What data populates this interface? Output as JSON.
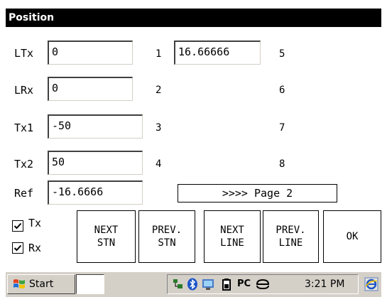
{
  "window": {
    "title": "Position"
  },
  "fields": [
    {
      "label": "LTx",
      "value": "0"
    },
    {
      "label": "LRx",
      "value": "0"
    },
    {
      "label": "Tx1",
      "value": "-50"
    },
    {
      "label": "Tx2",
      "value": "50"
    },
    {
      "label": "Ref",
      "value": "-16.6666"
    }
  ],
  "channels": {
    "col1": [
      "1",
      "2",
      "3",
      "4"
    ],
    "col2": [
      "5",
      "6",
      "7",
      "8"
    ],
    "channel1_value": "16.66666"
  },
  "page_button": "&gt;&gt;&gt;&gt; Page 2",
  "checkboxes": [
    {
      "label": "Tx",
      "checked": true
    },
    {
      "label": "Rx",
      "checked": true
    }
  ],
  "buttons": {
    "next_stn": [
      "NEXT",
      "STN"
    ],
    "prev_stn": [
      "PREV.",
      "STN"
    ],
    "next_line": [
      "NEXT",
      "LINE"
    ],
    "prev_line": [
      "PREV.",
      "LINE"
    ],
    "ok": "OK"
  },
  "taskbar": {
    "start_label": "Start",
    "tray_text_pc": "PC",
    "clock": "3:21 PM",
    "icons": [
      "network-icon",
      "bluetooth-icon",
      "monitor-icon",
      "battery-icon",
      "pc-connection-icon",
      "sync-icon",
      "ie-icon"
    ]
  }
}
